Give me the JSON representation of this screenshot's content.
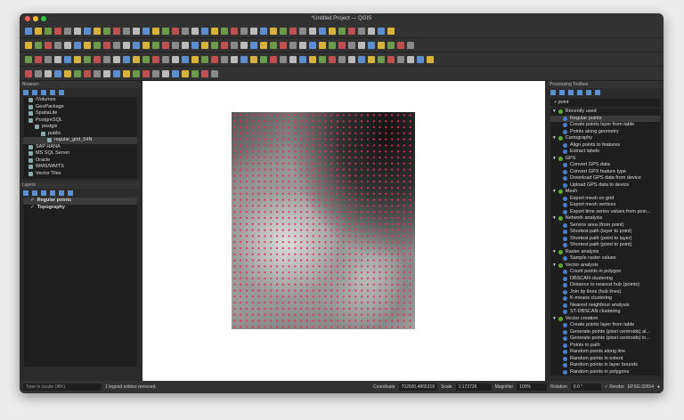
{
  "window": {
    "title": "*Untitled Project — QGIS"
  },
  "browser": {
    "title": "Browser",
    "items": [
      {
        "label": "/Volumes",
        "indent": 0
      },
      {
        "label": "GeoPackage",
        "indent": 0
      },
      {
        "label": "SpatiaLite",
        "indent": 0
      },
      {
        "label": "PostgreSQL",
        "indent": 0
      },
      {
        "label": "postgis",
        "indent": 1
      },
      {
        "label": "public",
        "indent": 2
      },
      {
        "label": "regular_grid_54N",
        "indent": 3,
        "selected": true
      },
      {
        "label": "SAP HANA",
        "indent": 0
      },
      {
        "label": "MS SQL Server",
        "indent": 0
      },
      {
        "label": "Oracle",
        "indent": 0
      },
      {
        "label": "WMS/WMTS",
        "indent": 0
      },
      {
        "label": "Vector Tiles",
        "indent": 0
      }
    ]
  },
  "layers": {
    "title": "Layers",
    "items": [
      {
        "label": "Regular points",
        "checked": true
      },
      {
        "label": "Topography",
        "checked": true
      }
    ]
  },
  "toolbox": {
    "title": "Processing Toolbox",
    "search": "point",
    "groups": [
      {
        "label": "Recently used",
        "items": [
          "Regular points",
          "Create points layer from table",
          "Points along geometry"
        ]
      },
      {
        "label": "Cartography",
        "items": [
          "Align points to features",
          "Extract labels"
        ]
      },
      {
        "label": "GPS",
        "items": [
          "Convert GPS data",
          "Convert GPX feature type",
          "Download GPS data from device",
          "Upload GPS data to device"
        ]
      },
      {
        "label": "Mesh",
        "items": [
          "Export mesh on grid",
          "Export mesh vertices",
          "Export time series values from poin..."
        ]
      },
      {
        "label": "Network analysis",
        "items": [
          "Service area (from point)",
          "Shortest path (layer to point)",
          "Shortest path (point to layer)",
          "Shortest path (point to point)"
        ]
      },
      {
        "label": "Raster analysis",
        "items": [
          "Sample raster values"
        ]
      },
      {
        "label": "Vector analysis",
        "items": [
          "Count points in polygon",
          "DBSCAN clustering",
          "Distance to nearest hub (points)",
          "Join by lines (hub lines)",
          "K-means clustering",
          "Nearest neighbour analysis",
          "ST-DBSCAN clustering"
        ]
      },
      {
        "label": "Vector creation",
        "items": [
          "Create points layer from table",
          "Generate points (pixel centroids) al...",
          "Generate points (pixel centroids) in...",
          "Points to path",
          "Random points along line",
          "Random points in extent",
          "Random points in layer bounds",
          "Random points in polygons"
        ]
      }
    ]
  },
  "status": {
    "locate_placeholder": "Type to locate (⌘K)",
    "message": "1 legend entries removed.",
    "coordinate_label": "Coordinate",
    "coordinate": "702600,4865319",
    "scale_label": "Scale",
    "scale": "1:172726",
    "magnifier_label": "Magnifier",
    "magnifier": "100%",
    "rotation_label": "Rotation",
    "rotation": "0.0 °",
    "render_label": "Render",
    "crs": "EPSG:32654"
  }
}
